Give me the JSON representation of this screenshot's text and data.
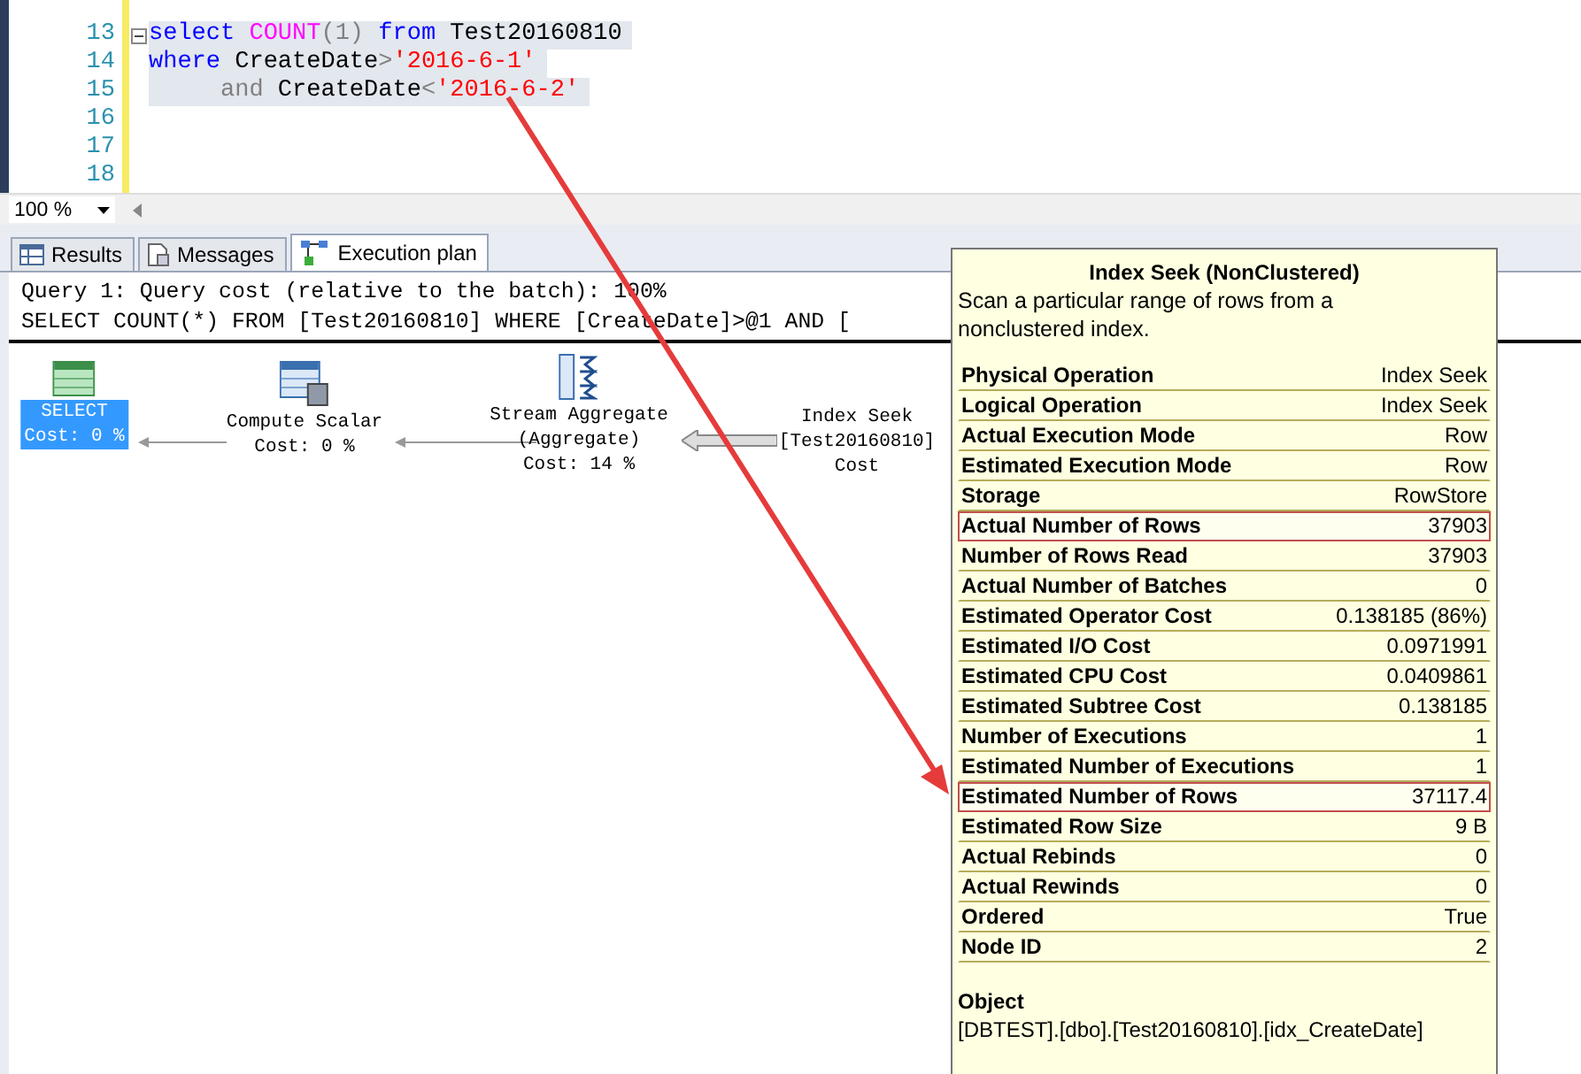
{
  "editor": {
    "lines": [
      {
        "number": "13",
        "selected": true,
        "collapsible": true,
        "tokens": [
          {
            "kind": "keyword",
            "text": "select "
          },
          {
            "kind": "function",
            "text": "COUNT"
          },
          {
            "kind": "operator",
            "text": "(1) "
          },
          {
            "kind": "keyword",
            "text": "from"
          },
          {
            "kind": "plain",
            "text": " Test20160810"
          }
        ]
      },
      {
        "number": "14",
        "selected": true,
        "tokens": [
          {
            "kind": "keyword",
            "text": "where"
          },
          {
            "kind": "plain",
            "text": " CreateDate"
          },
          {
            "kind": "operator",
            "text": ">"
          },
          {
            "kind": "string",
            "text": "'2016-6-1'"
          }
        ]
      },
      {
        "number": "15",
        "selected": true,
        "tokens": [
          {
            "kind": "operator",
            "text": "     and"
          },
          {
            "kind": "plain",
            "text": " CreateDate"
          },
          {
            "kind": "operator",
            "text": "<"
          },
          {
            "kind": "string",
            "text": "'2016-6-2'"
          }
        ]
      },
      {
        "number": "16",
        "selected": false
      },
      {
        "number": "17",
        "selected": false
      },
      {
        "number": "18",
        "selected": false
      }
    ],
    "zoom": "100 %"
  },
  "tabs": [
    {
      "label": "Results",
      "selected": false,
      "kind": "results"
    },
    {
      "label": "Messages",
      "selected": false,
      "kind": "messages"
    },
    {
      "label": "Execution plan",
      "selected": true,
      "kind": "plan"
    }
  ],
  "plan": {
    "header": [
      "Query 1: Query cost (relative to the batch): 100%",
      "SELECT COUNT(*) FROM [Test20160810] WHERE [CreateDate]>@1 AND ["
    ],
    "nodes": [
      {
        "kind": "select",
        "selected": true,
        "lines": [
          "SELECT",
          "Cost: 0 %"
        ]
      },
      {
        "kind": "compute",
        "selected": false,
        "lines": [
          "Compute Scalar",
          "Cost: 0 %"
        ]
      },
      {
        "kind": "aggregate",
        "selected": false,
        "lines": [
          "Stream Aggregate",
          "(Aggregate)",
          "Cost: 14 %"
        ]
      },
      {
        "kind": "seek",
        "selected": false,
        "lines": [
          "Index Seek",
          "[Test20160810]",
          "Cost"
        ]
      }
    ]
  },
  "tooltip": {
    "title": "Index Seek (NonClustered)",
    "description": "Scan a particular range of rows from a nonclustered index.",
    "rows": [
      {
        "label": "Physical Operation",
        "value": "Index Seek",
        "highlighted": false
      },
      {
        "label": "Logical Operation",
        "value": "Index Seek",
        "highlighted": false
      },
      {
        "label": "Actual Execution Mode",
        "value": "Row",
        "highlighted": false
      },
      {
        "label": "Estimated Execution Mode",
        "value": "Row",
        "highlighted": false
      },
      {
        "label": "Storage",
        "value": "RowStore",
        "highlighted": false
      },
      {
        "label": "Actual Number of Rows",
        "value": "37903",
        "highlighted": true
      },
      {
        "label": "Number of Rows Read",
        "value": "37903",
        "highlighted": false
      },
      {
        "label": "Actual Number of Batches",
        "value": "0",
        "highlighted": false
      },
      {
        "label": "Estimated Operator Cost",
        "value": "0.138185 (86%)",
        "highlighted": false
      },
      {
        "label": "Estimated I/O Cost",
        "value": "0.0971991",
        "highlighted": false
      },
      {
        "label": "Estimated CPU Cost",
        "value": "0.0409861",
        "highlighted": false
      },
      {
        "label": "Estimated Subtree Cost",
        "value": "0.138185",
        "highlighted": false
      },
      {
        "label": "Number of Executions",
        "value": "1",
        "highlighted": false
      },
      {
        "label": "Estimated Number of Executions",
        "value": "1",
        "highlighted": false
      },
      {
        "label": "Estimated Number of Rows",
        "value": "37117.4",
        "highlighted": true
      },
      {
        "label": "Estimated Row Size",
        "value": "9 B",
        "highlighted": false
      },
      {
        "label": "Actual Rebinds",
        "value": "0",
        "highlighted": false
      },
      {
        "label": "Actual Rewinds",
        "value": "0",
        "highlighted": false
      },
      {
        "label": "Ordered",
        "value": "True",
        "highlighted": false
      },
      {
        "label": "Node ID",
        "value": "2",
        "highlighted": false
      }
    ],
    "object_label": "Object",
    "object_value": "[DBTEST].[dbo].[Test20160810].[idx_CreateDate]"
  }
}
